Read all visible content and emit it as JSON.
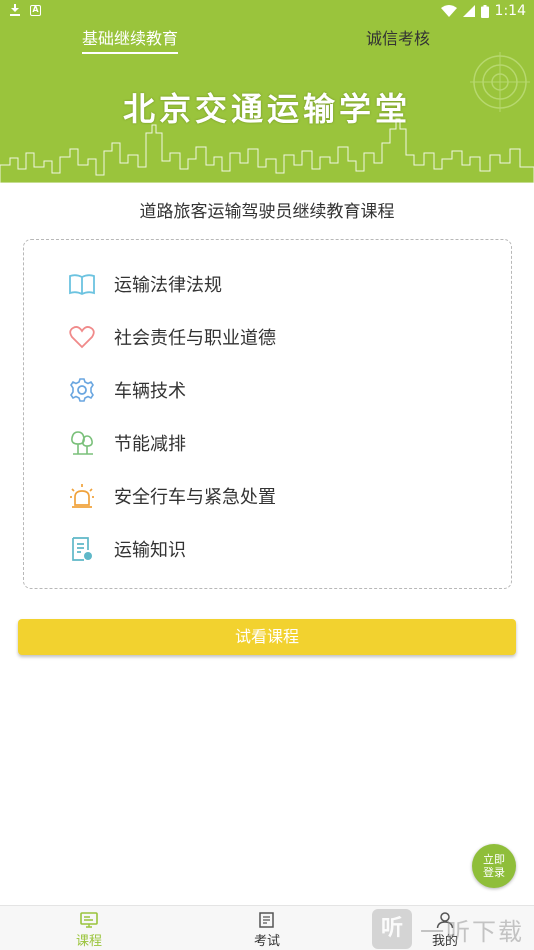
{
  "statusbar": {
    "time": "1:14"
  },
  "tabs": [
    {
      "label": "基础继续教育",
      "active": true
    },
    {
      "label": "诚信考核",
      "active": false
    }
  ],
  "banner": {
    "title": "北京交通运输学堂"
  },
  "page": {
    "subtitle": "道路旅客运输驾驶员继续教育课程"
  },
  "courses": [
    {
      "label": "运输法律法规",
      "icon": "book-icon",
      "color": "#6cc3e0"
    },
    {
      "label": "社会责任与职业道德",
      "icon": "heart-icon",
      "color": "#f08a8a"
    },
    {
      "label": "车辆技术",
      "icon": "gear-icon",
      "color": "#6aa6e0"
    },
    {
      "label": "节能减排",
      "icon": "tree-icon",
      "color": "#7ac07a"
    },
    {
      "label": "安全行车与紧急处置",
      "icon": "siren-icon",
      "color": "#f0a23c"
    },
    {
      "label": "运输知识",
      "icon": "document-icon",
      "color": "#5fb8c8"
    }
  ],
  "trial_button": {
    "label": "试看课程"
  },
  "float_login": {
    "line1": "立即",
    "line2": "登录"
  },
  "bottom_nav": [
    {
      "label": "课程",
      "icon": "monitor-icon",
      "active": true
    },
    {
      "label": "考试",
      "icon": "edit-icon",
      "active": false
    },
    {
      "label": "我的",
      "icon": "user-icon",
      "active": false
    }
  ],
  "watermark": {
    "badge": "听",
    "text": "一听下载"
  },
  "colors": {
    "brand_green": "#9ac43c",
    "button_yellow": "#f2d22f"
  }
}
